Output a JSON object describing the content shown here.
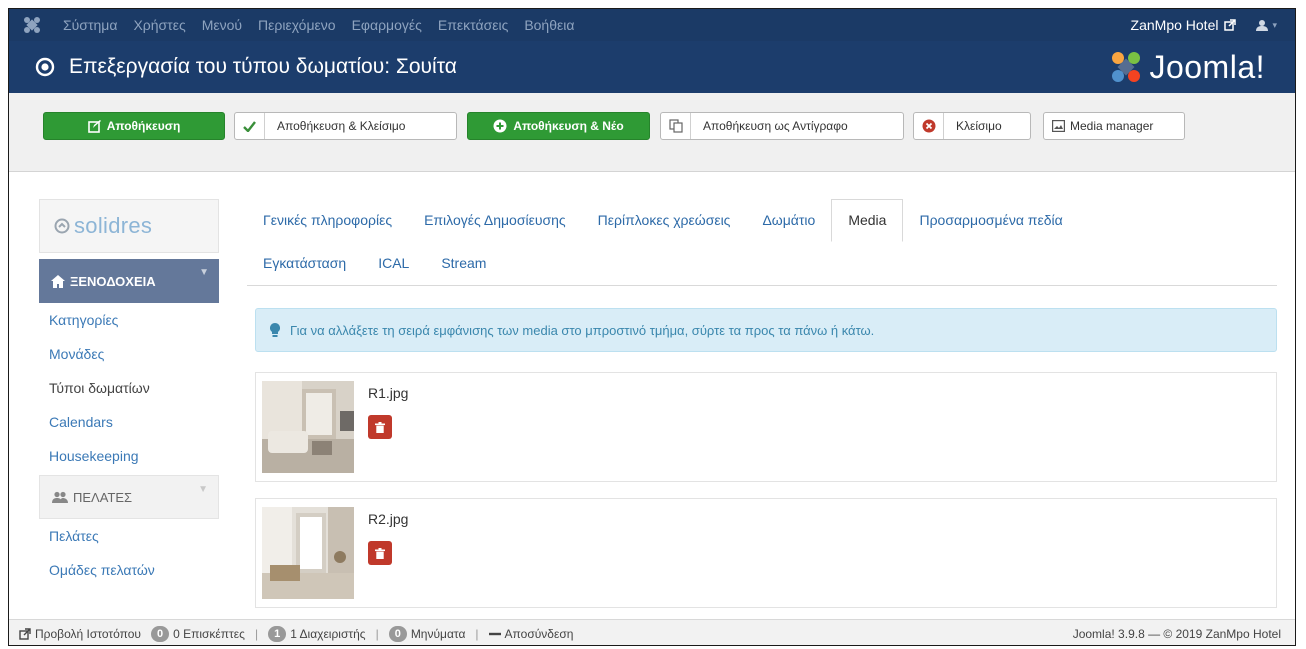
{
  "navbar": {
    "menu": [
      "Σύστημα",
      "Χρήστες",
      "Μενού",
      "Περιεχόμενο",
      "Εφαρμογές",
      "Επεκτάσεις",
      "Βοήθεια"
    ],
    "site_name": "ZanMpo Hotel",
    "icons": {
      "logo": "joomla-icon",
      "external": "external-link-icon",
      "user": "user-icon"
    }
  },
  "header": {
    "title": "Επεξεργασία του τύπου δωματίου: Σουίτα",
    "brand": "Joomla!"
  },
  "toolbar": {
    "save": "Αποθήκευση",
    "save_close": "Αποθήκευση & Κλείσιμο",
    "save_new": "Αποθήκευση & Νέο",
    "save_copy": "Αποθήκευση ως Αντίγραφο",
    "close": "Κλείσιμο",
    "media_manager": "Media manager"
  },
  "sidebar": {
    "brand": "solidres",
    "sections": [
      {
        "title": "ΞΕΝΟΔΟΧΕΙΑ",
        "items": [
          "Κατηγορίες",
          "Μονάδες",
          "Τύποι δωματίων",
          "Calendars",
          "Housekeeping"
        ]
      },
      {
        "title": "ΠΕΛΑΤΕΣ",
        "items": [
          "Πελάτες",
          "Ομάδες πελατών"
        ]
      }
    ]
  },
  "tabs": {
    "row1": [
      "Γενικές πληροφορίες",
      "Επιλογές Δημοσίευσης",
      "Περίπλοκες χρεώσεις",
      "Δωμάτιο",
      "Media",
      "Προσαρμοσμένα πεδία"
    ],
    "row2": [
      "Εγκατάσταση",
      "ICAL",
      "Stream"
    ],
    "active": "Media"
  },
  "alert": "Για να αλλάξετε τη σειρά εμφάνισης των media στο μπροστινό τμήμα, σύρτε τα προς τα πάνω ή κάτω.",
  "media": [
    {
      "name": "R1.jpg"
    },
    {
      "name": "R2.jpg"
    }
  ],
  "status": {
    "view_site": "Προβολή Ιστοτόπου",
    "visitors_count": "0",
    "visitors_label": "0 Επισκέπτες",
    "admins_count": "1",
    "admins_label": "1 Διαχειριστής",
    "messages_count": "0",
    "messages_label": "Μηνύματα",
    "logout": "Αποσύνδεση",
    "version": "Joomla! 3.9.8 — © 2019 ZanMpo Hotel"
  },
  "colors": {
    "navbar": "#1b3a66",
    "header": "#1c3d6c",
    "green": "#2f9a35",
    "red": "#c0392b",
    "link": "#3b79b6"
  }
}
